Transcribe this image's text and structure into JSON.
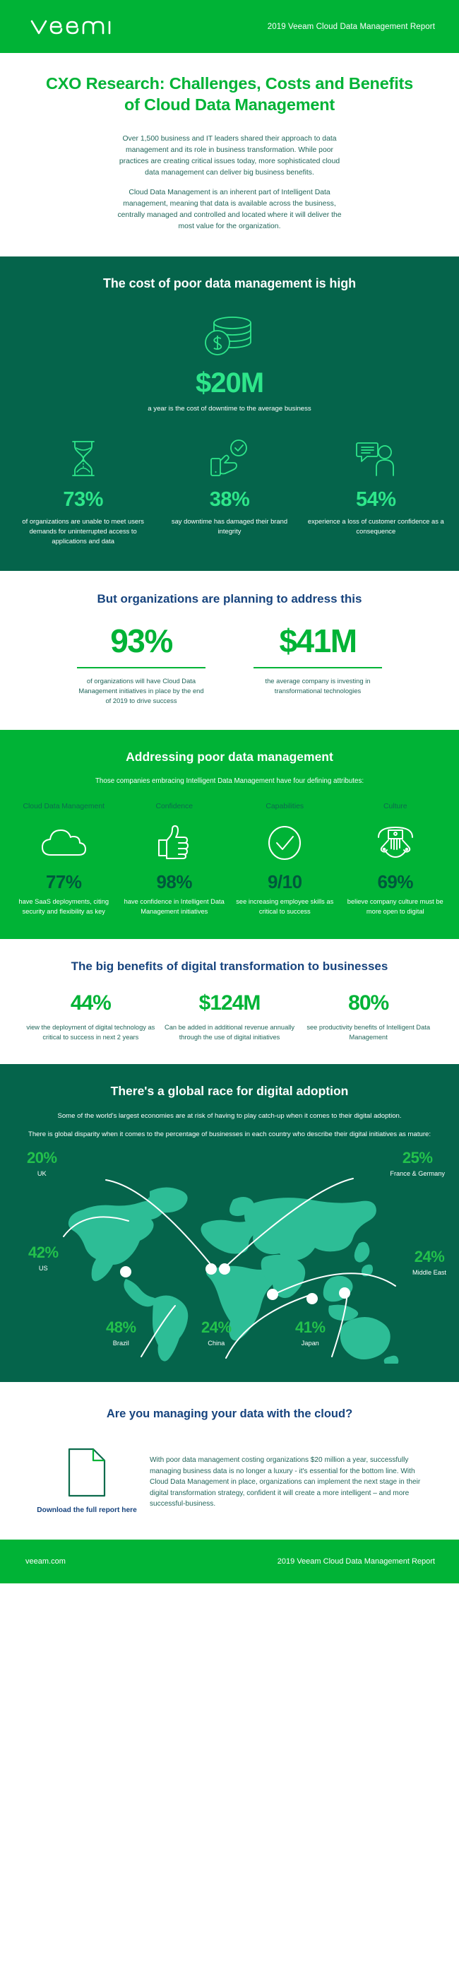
{
  "brand": {
    "accent_green": "#00b336",
    "dark_green": "#05644b",
    "mint_green": "#2ee68a",
    "navy": "#17447e",
    "teal_text": "#21665a",
    "logo_text": "veeam"
  },
  "header": {
    "report_title": "2019 Veeam Cloud Data Management Report"
  },
  "hero": {
    "title": "CXO Research: Challenges, Costs and Benefits of Cloud Data Management",
    "paragraph_1": "Over 1,500 business and IT leaders shared their approach to data management and its role in business transformation. While poor practices are creating critical issues today, more sophisticated cloud data management can deliver big business benefits.",
    "paragraph_2": "Cloud Data Management is an inherent part of Intelligent Data management, meaning that data is available across the business, centrally managed and controlled and located where it will deliver the most value for the organization."
  },
  "cost_section": {
    "heading": "The cost of poor data management is high",
    "hero_icon": "coin-stack-icon",
    "hero_value": "$20M",
    "hero_caption": "a year is the cost of downtime to the average business",
    "stats": [
      {
        "icon": "hourglass-icon",
        "value": "73%",
        "caption": "of organizations are unable to meet users demands for uninterrupted access to applications and data"
      },
      {
        "icon": "hand-check-icon",
        "value": "38%",
        "caption": "say downtime has damaged their brand integrity"
      },
      {
        "icon": "speech-person-icon",
        "value": "54%",
        "caption": "experience a loss of customer confidence as a consequence"
      }
    ]
  },
  "planning_section": {
    "heading": "But organizations are planning to address this",
    "stats": [
      {
        "value": "93%",
        "caption": "of organizations will have Cloud Data Management initiatives in place by the end of 2019 to drive success"
      },
      {
        "value": "$41M",
        "caption": "the average company is investing in transformational technologies"
      }
    ]
  },
  "attributes_section": {
    "heading": "Addressing poor data management",
    "intro": "Those companies embracing Intelligent Data Management have four defining attributes:",
    "items": [
      {
        "tag": "Cloud Data Management",
        "icon": "cloud-icon",
        "value": "77%",
        "caption": "have SaaS deployments, citing security and flexibility as key"
      },
      {
        "tag": "Confidence",
        "icon": "thumbs-up-icon",
        "value": "98%",
        "caption": "have confidence in Intelligent Data Management initiatives"
      },
      {
        "tag": "Capabilities",
        "icon": "check-circle-icon",
        "value": "9/10",
        "caption": "see increasing employee skills as critical to success"
      },
      {
        "tag": "Culture",
        "icon": "handshake-icon",
        "value": "69%",
        "caption": "believe company culture must be more open to digital"
      }
    ]
  },
  "benefits_section": {
    "heading": "The big benefits of digital transformation to businesses",
    "stats": [
      {
        "value": "44%",
        "caption": "view the deployment of digital technology as critical to success in next 2 years"
      },
      {
        "value": "$124M",
        "caption": "Can be added in additional revenue annually through the use of digital initiatives"
      },
      {
        "value": "80%",
        "caption": "see productivity benefits of Intelligent Data Management"
      }
    ]
  },
  "map_section": {
    "heading": "There's a global race for digital adoption",
    "intro_1": "Some of the world's largest economies are at risk of having to play catch-up when it comes to their digital adoption.",
    "intro_2": "There is global disparity when it comes to the percentage of businesses in each country who describe their digital initiatives as mature:",
    "labels": [
      {
        "value": "20%",
        "name": "UK"
      },
      {
        "value": "25%",
        "name": "France & Germany"
      },
      {
        "value": "42%",
        "name": "US"
      },
      {
        "value": "24%",
        "name": "Middle East"
      },
      {
        "value": "48%",
        "name": "Brazil"
      },
      {
        "value": "24%",
        "name": "China"
      },
      {
        "value": "41%",
        "name": "Japan"
      }
    ]
  },
  "chart_data": {
    "type": "map",
    "title": "There's a global race for digital adoption",
    "subtitle": "Percentage of businesses in each country who describe their digital initiatives as mature",
    "unit": "percent",
    "categories": [
      "UK",
      "France & Germany",
      "US",
      "Middle East",
      "Brazil",
      "China",
      "Japan"
    ],
    "values": [
      20,
      25,
      42,
      24,
      48,
      24,
      41
    ],
    "legend": "none",
    "grid": false,
    "ylim": [
      0,
      100
    ]
  },
  "cta_section": {
    "heading": "Are you managing your data with the cloud?",
    "doc_icon": "document-icon",
    "link_label": "Download the full report here",
    "body": "With poor data management costing organizations $20 million a year, successfully managing business data is no longer a luxury - it's essential for the bottom line. With Cloud Data Management in place, organizations can implement the next stage in their digital transformation strategy, confident it will create a more intelligent – and more successful-business."
  },
  "footer": {
    "website": "veeam.com",
    "report_title": "2019 Veeam Cloud Data Management Report"
  }
}
